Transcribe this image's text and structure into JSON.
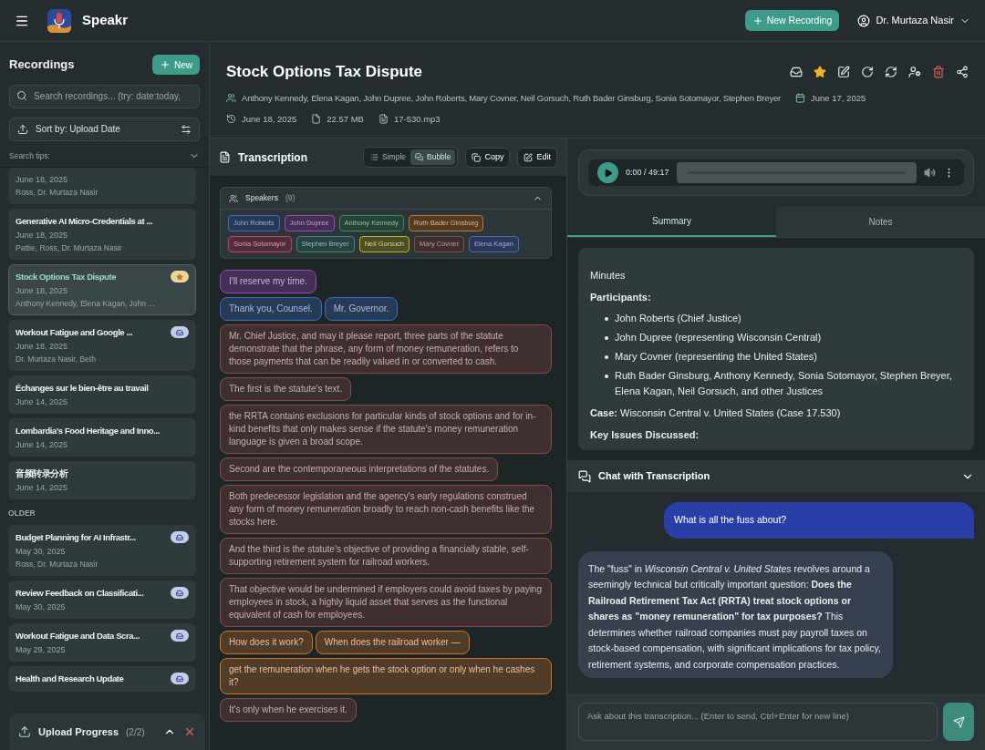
{
  "app": {
    "name": "Speakr"
  },
  "header": {
    "new_recording": "New Recording",
    "user": "Dr. Murtaza Nasir"
  },
  "sidebar": {
    "title": "Recordings",
    "new_button": "New",
    "search": {
      "placeholder": "Search recordings... (try: date:today,"
    },
    "sort": "Sort by: Upload Date",
    "search_tips": "Search tips:",
    "groups": [
      {
        "items": [
          {
            "date": "June 18, 2025",
            "participants": "Ross, Dr. Murtaza Nasir",
            "selected": false
          },
          {
            "title": "Generative AI Micro-Credentials at ...",
            "date": "June 18, 2025",
            "participants": "Pattie, Ross, Dr. Murtaza Nasir",
            "selected": false
          },
          {
            "title": "Stock Options Tax Dispute",
            "date": "June 18, 2025",
            "participants": "Anthony Kennedy, Elena Kagan, John ...",
            "badge": {
              "kind": "star"
            },
            "selected": true
          },
          {
            "title": "Workout Fatigue and Google ...",
            "date": "June 18, 2025",
            "participants": "Dr. Murtaza Nasir, Beth",
            "badge": {
              "kind": "inbox"
            },
            "selected": false
          },
          {
            "title": "Échanges sur le bien-être au travail",
            "date": "June 14, 2025",
            "selected": false
          },
          {
            "title": "Lombardia's Food Heritage and Inno...",
            "date": "June 14, 2025",
            "selected": false
          },
          {
            "title": "音频转录分析",
            "date": "June 14, 2025",
            "selected": false
          }
        ]
      },
      {
        "label": "OLDER",
        "items": [
          {
            "title": "Budget Planning for AI Infrastr...",
            "date": "May 30, 2025",
            "participants": "Ross, Dr. Murtaza Nasir",
            "badge": {
              "kind": "inbox"
            },
            "selected": false
          },
          {
            "title": "Review Feedback on Classificati...",
            "date": "May 30, 2025",
            "badge": {
              "kind": "inbox"
            },
            "selected": false
          },
          {
            "title": "Workout Fatigue and Data Scra...",
            "date": "May 29, 2025",
            "badge": {
              "kind": "inbox"
            },
            "selected": false
          },
          {
            "title": "Health and Research Update",
            "badge": {
              "kind": "inbox"
            },
            "selected": false
          }
        ]
      }
    ],
    "upload": {
      "title": "Upload Progress",
      "count": "(2/2)"
    }
  },
  "recording": {
    "title": "Stock Options Tax Dispute",
    "starred": true,
    "participants": "Anthony Kennedy, Elena Kagan, John Dupree, John Roberts, Mary Covner, Neil Gorsuch, Ruth Bader Ginsburg, Sonia Sotomayor, Stephen Breyer",
    "recorded_date": "June 17, 2025",
    "upload_date": "June 18, 2025",
    "size": "22.57 MB",
    "file": "17-530.mp3"
  },
  "transcription": {
    "title": "Transcription",
    "views": [
      {
        "label": "Simple",
        "kind": "list",
        "selected": false
      },
      {
        "label": "Bubble",
        "kind": "bubble",
        "selected": true
      }
    ],
    "copy": "Copy",
    "edit": "Edit",
    "speakers": {
      "title": "Speakers",
      "count": "(9)",
      "expanded": true,
      "items": [
        {
          "name": "John Roberts",
          "color": "#3b6bc4"
        },
        {
          "name": "John Dupree",
          "color": "#9b45c0"
        },
        {
          "name": "Anthony Kennedy",
          "color": "#3a8a5c"
        },
        {
          "name": "Ruth Bader Ginsburg",
          "color": "#c87428"
        },
        {
          "name": "Sonia Sotomayor",
          "color": "#c04462"
        },
        {
          "name": "Stephen Breyer",
          "color": "#3a8a80"
        },
        {
          "name": "Neil Gorsuch",
          "color": "#c0b020"
        },
        {
          "name": "Mary Covner",
          "color": "#8a4a44"
        },
        {
          "name": "Elena Kagan",
          "color": "#4468c8"
        }
      ]
    },
    "rows": [
      [
        {
          "text": "I'll reserve my time.",
          "color": "#9b45c0"
        }
      ],
      [
        {
          "text": "Thank you, Counsel.",
          "color": "#3b6bc4"
        },
        {
          "text": "Mr. Governor.",
          "color": "#3b6bc4"
        }
      ],
      [
        {
          "text": "Mr. Chief Justice, and may it please report, three parts of the statute demonstrate that the phrase, any form of money remuneration, refers to those payments that can be readily valued in or converted to cash.",
          "color": "#8a4a44"
        }
      ],
      [
        {
          "text": "The first is the statute's text.",
          "color": "#8a4a44"
        }
      ],
      [
        {
          "text": "the RRTA contains exclusions for particular kinds of stock options and for in-kind benefits that only makes sense if the statute's money remuneration language is given a broad scope.",
          "color": "#8a4a44"
        }
      ],
      [
        {
          "text": "Second are the contemporaneous interpretations of the statutes.",
          "color": "#8a4a44"
        }
      ],
      [
        {
          "text": "Both predecessor legislation and the agency's early regulations construed any form of money remuneration broadly to reach non-cash benefits like the stocks here.",
          "color": "#8a4a44"
        }
      ],
      [
        {
          "text": "And the third is the statute's objective of providing a financially stable, self-supporting retirement system for railroad workers.",
          "color": "#8a4a44"
        }
      ],
      [
        {
          "text": "That objective would be undermined if employers could avoid taxes by paying employees in stock, a highly liquid asset that serves as the functional equivalent of cash for employees.",
          "color": "#8a4a44"
        }
      ],
      [
        {
          "text": "How does it work?",
          "color": "#c87428"
        },
        {
          "text": "When does the railroad worker —",
          "color": "#c87428"
        }
      ],
      [
        {
          "text": "get the remuneration when he gets the stock option or only when he cashes it?",
          "color": "#c87428"
        }
      ],
      [
        {
          "text": "It's only when he exercises it.",
          "color": "#8a4a44"
        }
      ]
    ]
  },
  "player": {
    "time": "0:00 / 49:17"
  },
  "tabs": [
    {
      "label": "Summary",
      "selected": true
    },
    {
      "label": "Notes",
      "selected": false
    }
  ],
  "summary": [
    {
      "kind": "paragraph",
      "text": "Minutes"
    },
    {
      "kind": "heading",
      "text": "Participants:"
    },
    {
      "kind": "list",
      "items": [
        "John Roberts (Chief Justice)",
        "John Dupree (representing Wisconsin Central)",
        "Mary Covner (representing the United States)",
        "Ruth Bader Ginsburg, Anthony Kennedy, Sonia Sotomayor, Stephen Breyer, Elena Kagan, Neil Gorsuch, and other Justices"
      ]
    },
    {
      "kind": "paragraph",
      "text": "**Case:** Wisconsin Central v. United States (Case 17.530)"
    },
    {
      "kind": "heading",
      "text": "Key Issues Discussed:"
    }
  ],
  "chat": {
    "title": "Chat with Transcription",
    "messages": [
      {
        "kind": "user",
        "text": "What is all the fuss about?"
      },
      {
        "kind": "assistant",
        "text": "The \"fuss\" in *Wisconsin Central v. United States* revolves around a seemingly technical but critically important question: **Does the Railroad Retirement Tax Act (RRTA) treat stock options or shares as \"money remuneration\" for tax purposes?** This determines whether railroad companies must pay payroll taxes on stock-based compensation, with significant implications for tax policy, retirement systems, and corporate compensation practices."
      }
    ],
    "input": {
      "placeholder": "Ask about this transcription... (Enter to send, Ctrl+Enter for new line)"
    }
  }
}
